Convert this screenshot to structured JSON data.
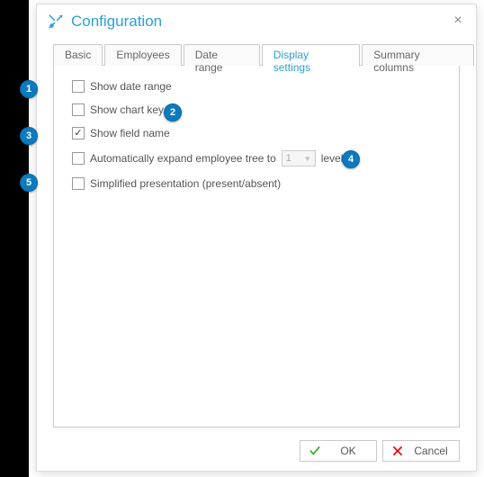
{
  "dialog": {
    "title": "Configuration"
  },
  "tabs": [
    {
      "label": "Basic",
      "active": false
    },
    {
      "label": "Employees",
      "active": false
    },
    {
      "label": "Date range",
      "active": false
    },
    {
      "label": "Display settings",
      "active": true
    },
    {
      "label": "Summary columns",
      "active": false
    }
  ],
  "options": {
    "show_date_range": {
      "label": "Show date range",
      "checked": false
    },
    "show_chart_key": {
      "label": "Show chart key",
      "checked": false
    },
    "show_field_name": {
      "label": "Show field name",
      "checked": true
    },
    "auto_expand": {
      "prefix": "Automatically expand employee tree to",
      "value": "1",
      "suffix": "level",
      "checked": false
    },
    "simplified": {
      "label": "Simplified presentation (present/absent)",
      "checked": false
    }
  },
  "buttons": {
    "ok": "OK",
    "cancel": "Cancel"
  },
  "callouts": [
    "1",
    "2",
    "3",
    "4",
    "5"
  ]
}
